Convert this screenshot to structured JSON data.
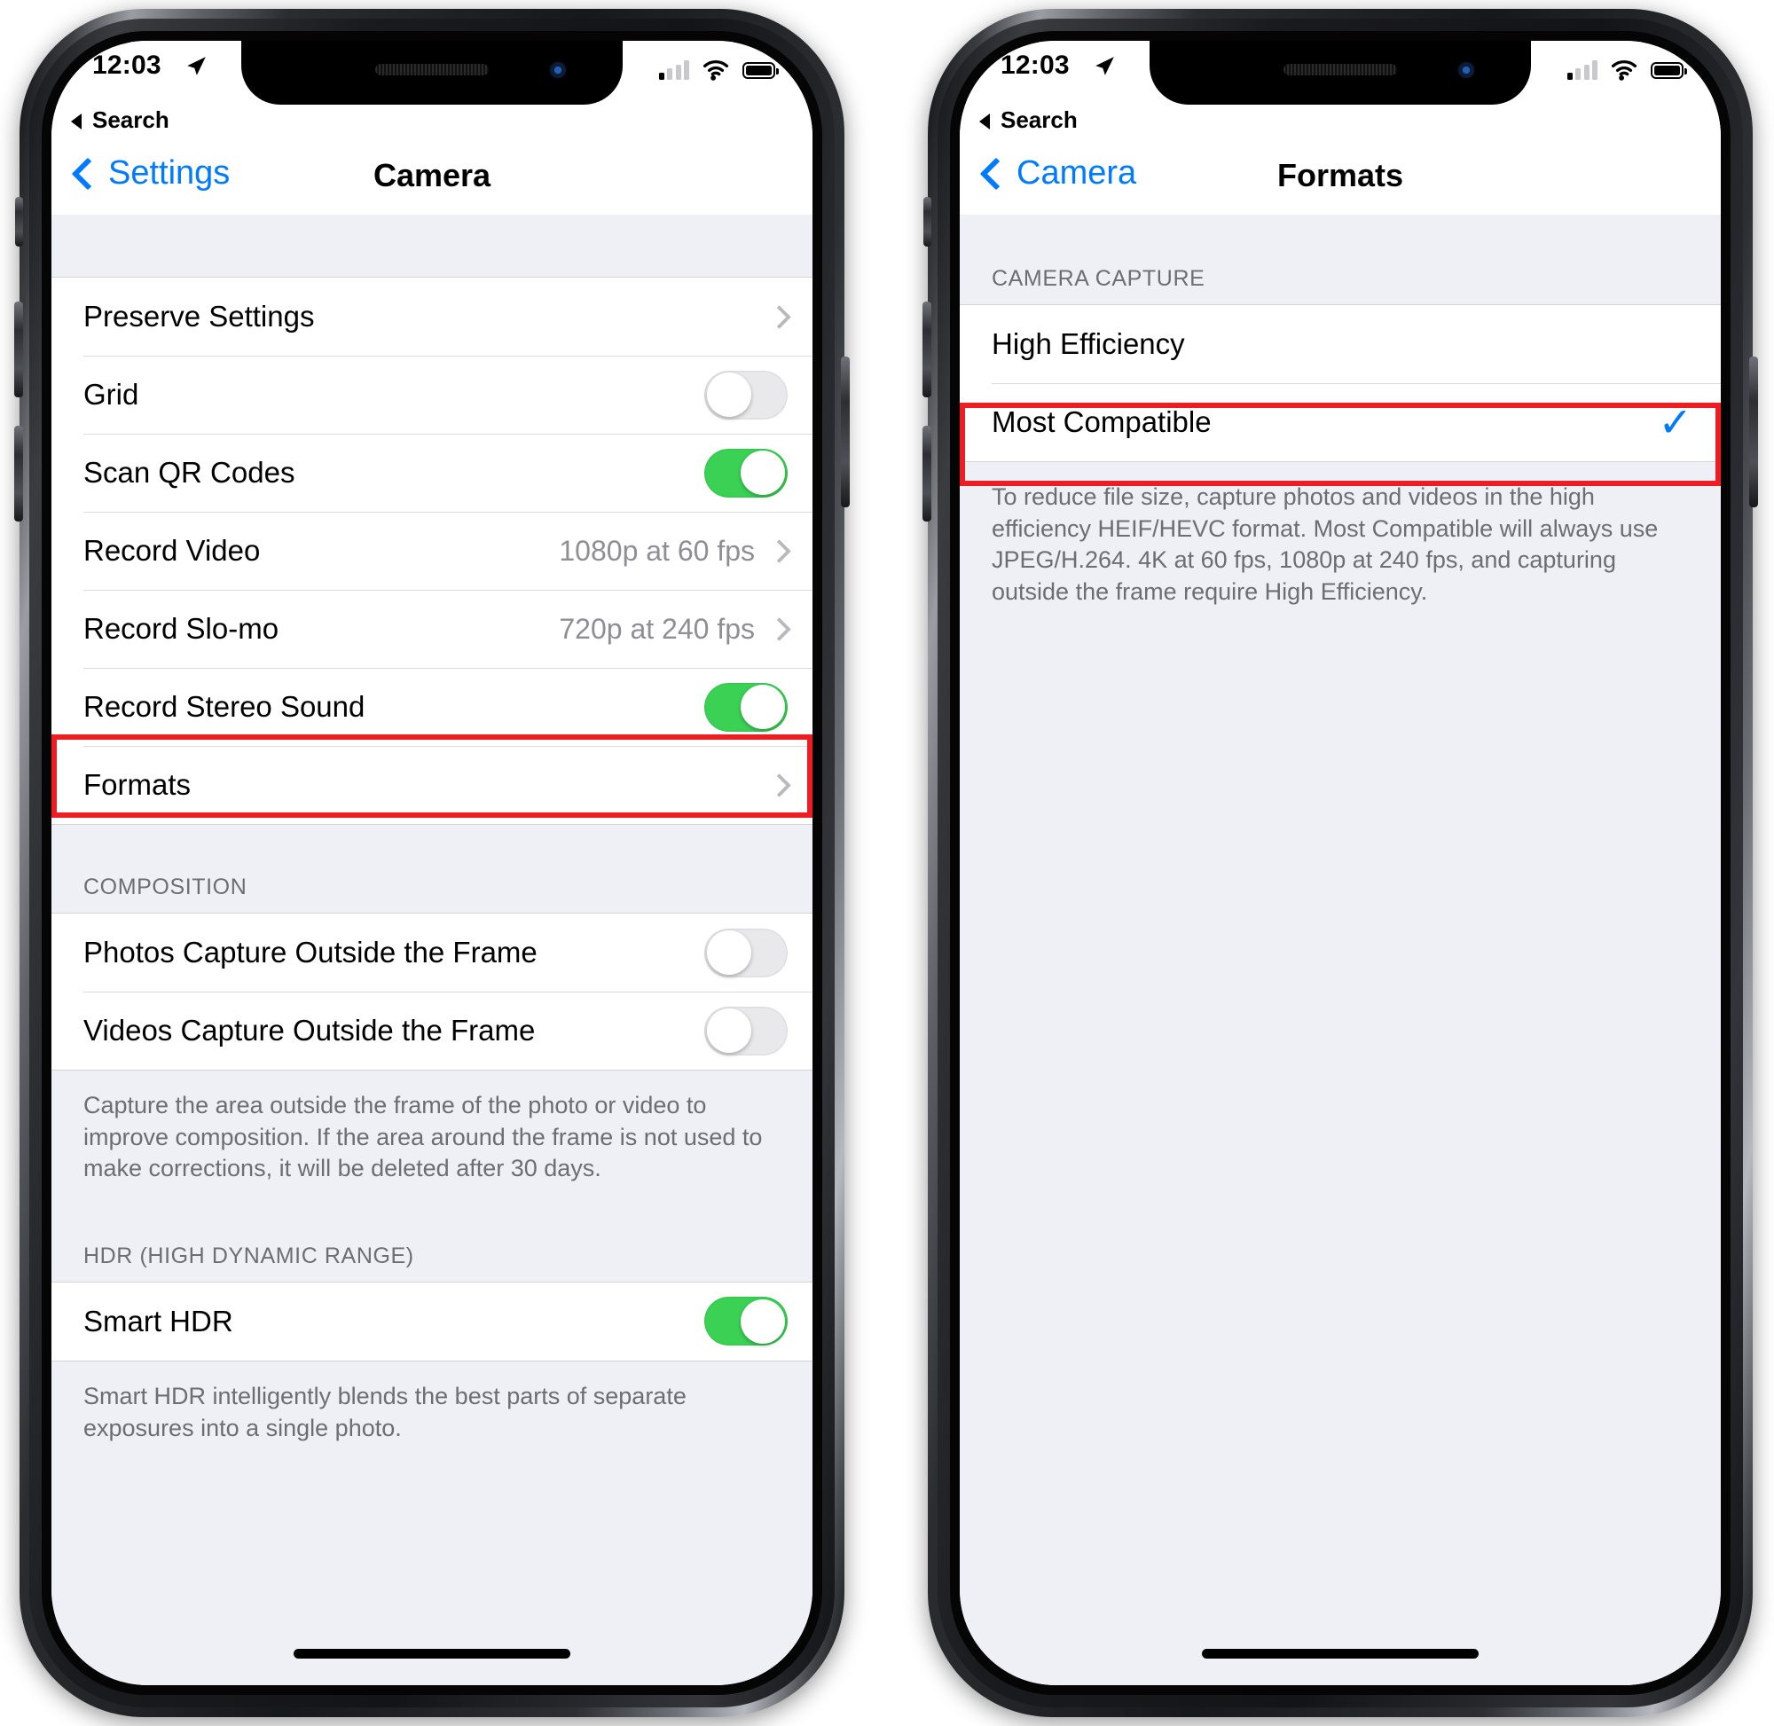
{
  "status_bar": {
    "time": "12:03",
    "location_icon": "location-arrow-icon",
    "back_to_app": "Search",
    "signal_icon": "cellular-signal-icon",
    "signal_bars_filled": 1,
    "signal_bars_total": 4,
    "wifi_icon": "wifi-icon",
    "battery_icon": "battery-full-icon"
  },
  "colors": {
    "accent_blue": "#007aff",
    "toggle_on_green": "#3ad155",
    "highlight_red": "#ee1d24",
    "secondary_text": "#8e8e93",
    "background": "#eff0f5"
  },
  "left_phone": {
    "nav": {
      "back_label": "Settings",
      "title": "Camera"
    },
    "sections": [
      {
        "header": "",
        "rows": [
          {
            "label": "Preserve Settings",
            "type": "disclosure",
            "value": ""
          },
          {
            "label": "Grid",
            "type": "toggle",
            "state": "off"
          },
          {
            "label": "Scan QR Codes",
            "type": "toggle",
            "state": "on"
          },
          {
            "label": "Record Video",
            "type": "disclosure",
            "value": "1080p at 60 fps"
          },
          {
            "label": "Record Slo-mo",
            "type": "disclosure",
            "value": "720p at 240 fps"
          },
          {
            "label": "Record Stereo Sound",
            "type": "toggle",
            "state": "on"
          },
          {
            "label": "Formats",
            "type": "disclosure",
            "value": "",
            "highlighted": true
          }
        ],
        "footer": ""
      },
      {
        "header": "COMPOSITION",
        "rows": [
          {
            "label": "Photos Capture Outside the Frame",
            "type": "toggle",
            "state": "off"
          },
          {
            "label": "Videos Capture Outside the Frame",
            "type": "toggle",
            "state": "off"
          }
        ],
        "footer": "Capture the area outside the frame of the photo or video to improve composition. If the area around the frame is not used to make corrections, it will be deleted after 30 days."
      },
      {
        "header": "HDR (HIGH DYNAMIC RANGE)",
        "rows": [
          {
            "label": "Smart HDR",
            "type": "toggle",
            "state": "on"
          }
        ],
        "footer": "Smart HDR intelligently blends the best parts of separate exposures into a single photo."
      }
    ]
  },
  "right_phone": {
    "nav": {
      "back_label": "Camera",
      "title": "Formats"
    },
    "sections": [
      {
        "header": "CAMERA CAPTURE",
        "rows": [
          {
            "label": "High Efficiency",
            "type": "option",
            "selected": false
          },
          {
            "label": "Most Compatible",
            "type": "option",
            "selected": true,
            "highlighted": true
          }
        ],
        "footer": "To reduce file size, capture photos and videos in the high efficiency HEIF/HEVC format. Most Compatible will always use JPEG/H.264. 4K at 60 fps, 1080p at 240 fps, and capturing outside the frame require High Efficiency."
      }
    ]
  }
}
